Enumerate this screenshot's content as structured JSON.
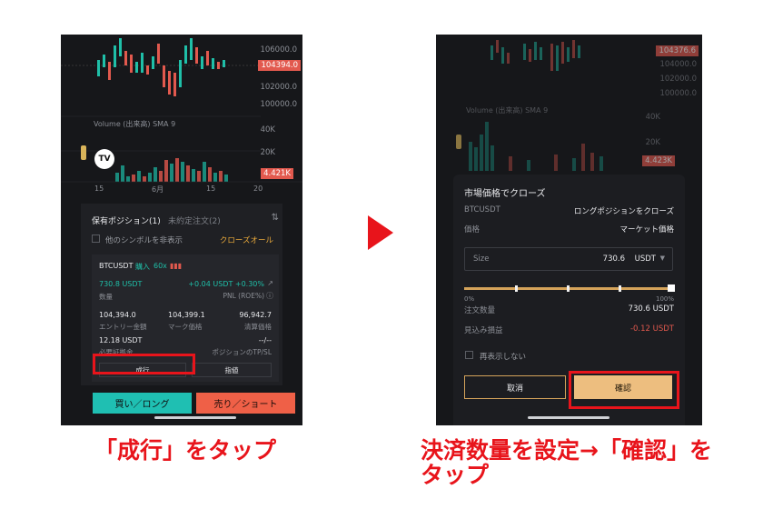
{
  "left": {
    "price_axis": [
      "106000.0",
      "104394.0",
      "102000.0",
      "100000.0"
    ],
    "price_tag": "104394.0",
    "volume_label": "Volume (出来高) SMA 9",
    "volume_axis": [
      "40K",
      "20K"
    ],
    "volume_tag": "4.421K",
    "x_axis": [
      "15",
      "6月",
      "15",
      "20"
    ],
    "tabs": {
      "positions": "保有ポジション(1)",
      "orders": "未約定注文(2)"
    },
    "hide_others": "他のシンボルを非表示",
    "close_all": "クローズオール",
    "position": {
      "symbol": "BTCUSDT",
      "side": "購入",
      "leverage": "60x",
      "size_value": "730.8 USDT",
      "size_label": "数量",
      "pnl_value": "+0.04 USDT +0.30%",
      "pnl_label": "PNL (ROE%)",
      "entry_value": "104,394.0",
      "entry_label": "エントリー金額",
      "mark_value": "104,399.1",
      "mark_label": "マーク価格",
      "liq_value": "96,942.7",
      "liq_label": "清算価格",
      "margin_value": "12.18 USDT",
      "margin_label": "必要証拠金",
      "tpsl_value": "--/--",
      "tpsl_label": "ポジションのTP/SL"
    },
    "market_button": "成行",
    "limit_button": "指値",
    "buy_button": "買い／ロング",
    "sell_button": "売り／ショート"
  },
  "right": {
    "price_tag": "104376.6",
    "price_axis": [
      "104000.0",
      "102000.0",
      "100000.0"
    ],
    "volume_label": "Volume (出来高) SMA 9",
    "volume_axis": [
      "40K",
      "20K"
    ],
    "volume_tag": "4.423K",
    "modal": {
      "title": "市場価格でクローズ",
      "symbol": "BTCUSDT",
      "action": "ロングポジションをクローズ",
      "price_label": "価格",
      "price_value": "マーケット価格",
      "size_label": "Size",
      "size_value": "730.6",
      "size_unit": "USDT",
      "slider_min": "0%",
      "slider_max": "100%",
      "slider_value": 1.0,
      "qty_label": "注文数量",
      "qty_value": "730.6 USDT",
      "pnl_label": "見込み損益",
      "pnl_value": "-0.12 USDT",
      "dont_show": "再表示しない",
      "cancel": "取消",
      "confirm": "確認"
    }
  },
  "captions": {
    "left": "「成行」をタップ",
    "right_line1": "決済数量を設定→「確認」を",
    "right_line2": "タップ"
  },
  "colors": {
    "accent_red": "#e8141b",
    "teal": "#1fbfb2",
    "salmon": "#ef6047",
    "gold": "#edbe7f"
  }
}
